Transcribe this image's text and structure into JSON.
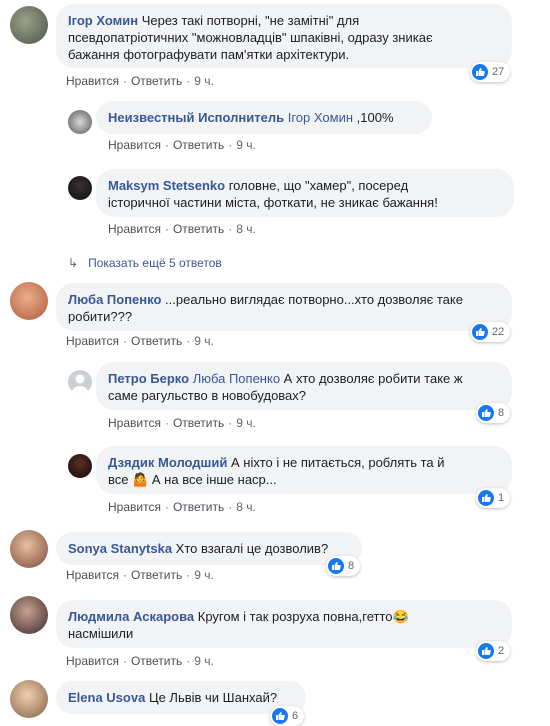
{
  "comments": [
    {
      "author": "Ігор Хомин",
      "tag": "",
      "text_lines": [
        "Через такі потворні, \"не замітні\" для",
        "псевдопатріотичних \"можновладців\" шпаківні, одразу зникає",
        "бажання фотографувати пам'ятки архітектури."
      ],
      "like": "Нравится",
      "reply": "Ответить",
      "time": "9 ч.",
      "reactions": "27"
    },
    {
      "author": "Неизвестный Исполнитель",
      "tag": "Ігор Хомин",
      "text_lines": [
        ",100%"
      ],
      "like": "Нравится",
      "reply": "Ответить",
      "time": "9 ч.",
      "reactions": ""
    },
    {
      "author": "Maksym Stetsenko",
      "tag": "",
      "text_lines": [
        "головне, що \"хамер\", посеред",
        "історичної частини міста, фоткати, не зникає бажання!"
      ],
      "like": "Нравится",
      "reply": "Ответить",
      "time": "8 ч.",
      "reactions": ""
    },
    {
      "author": "Люба Попенко",
      "tag": "",
      "text_lines": [
        "...реально виглядає потворно...хто дозволяє таке",
        "робити???"
      ],
      "like": "Нравится",
      "reply": "Ответить",
      "time": "9 ч.",
      "reactions": "22"
    },
    {
      "author": "Петро Берко",
      "tag": "Люба Попенко",
      "text_lines": [
        "А хто дозволяє робити таке ж",
        "саме рагульство в новобудовах?"
      ],
      "like": "Нравится",
      "reply": "Ответить",
      "time": "9 ч.",
      "reactions": "8"
    },
    {
      "author": "Дзядик Молодший",
      "tag": "",
      "text_lines": [
        "А ніхто і не питається, роблять та й",
        "все 🤷 А на все інше наср..."
      ],
      "like": "Нравится",
      "reply": "Ответить",
      "time": "8 ч.",
      "reactions": "1"
    },
    {
      "author": "Sonya Stanytska",
      "tag": "",
      "text_lines": [
        "Хто взагалі це дозволив?"
      ],
      "like": "Нравится",
      "reply": "Ответить",
      "time": "9 ч.",
      "reactions": "8"
    },
    {
      "author": "Людмила Аскарова",
      "tag": "",
      "text_lines": [
        "Кругом і так розруха повна,гетто😂",
        "насмішили"
      ],
      "like": "Нравится",
      "reply": "Ответить",
      "time": "9 ч.",
      "reactions": "2"
    },
    {
      "author": "Elena Usova",
      "tag": "",
      "text_lines": [
        "Це Львів чи Шанхай?"
      ],
      "like": "",
      "reply": "",
      "time": "",
      "reactions": "6"
    }
  ],
  "show_more_replies": "Показать ещё 5 ответов",
  "colors": {
    "link": "#385898",
    "bubble": "#f2f3f5",
    "like": "#1877f2",
    "meta": "#606770"
  }
}
